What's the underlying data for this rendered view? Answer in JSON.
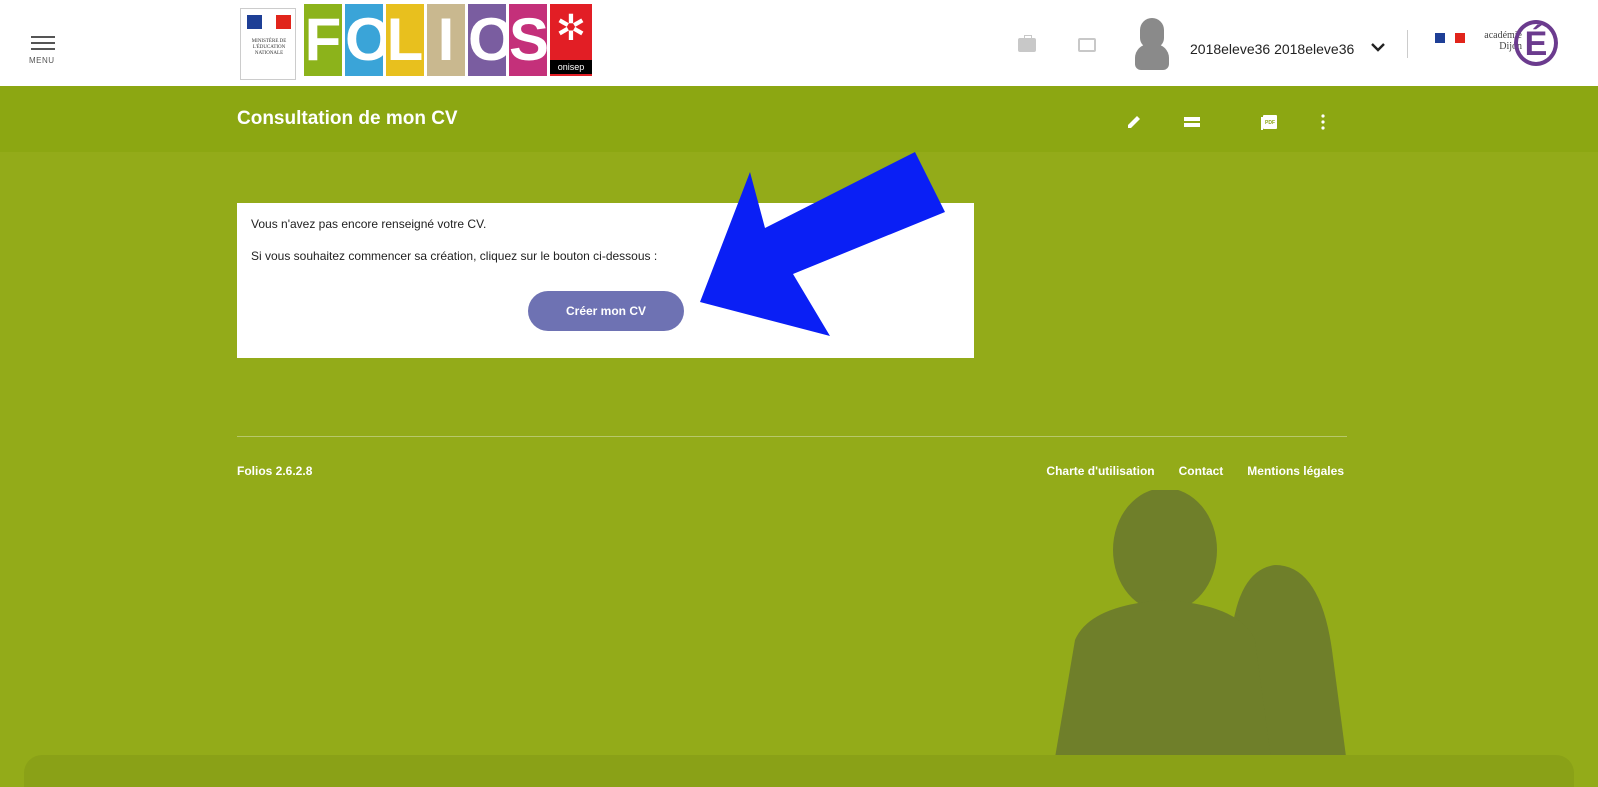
{
  "header": {
    "menu_label": "MENU",
    "gov_text": "MINISTÈRE DE L'ÉDUCATION NATIONALE",
    "logo_letters": [
      "F",
      "O",
      "L",
      "I",
      "O",
      "S"
    ],
    "logo_colors": [
      "#8cb31b",
      "#3aa4d8",
      "#e8c01e",
      "#c9b88f",
      "#7a5da0",
      "#c4307a"
    ],
    "onisep_label": "onisep",
    "username": "2018eleve36 2018eleve36",
    "academy_words": "académie Dijon",
    "academy_letter": "É"
  },
  "titlebar": {
    "title": "Consultation de mon CV",
    "pdf_label": "PDF"
  },
  "card": {
    "line1": "Vous n'avez pas encore renseigné votre CV.",
    "line2": "Si vous souhaitez commencer sa création, cliquez sur le bouton ci-dessous :",
    "button_label": "Créer mon CV"
  },
  "footer": {
    "version": "Folios 2.6.2.8",
    "links": [
      "Charte d'utilisation",
      "Contact",
      "Mentions légales"
    ]
  },
  "colors": {
    "page_bg": "#93ab19",
    "titlebar_bg": "#8ca712",
    "button_bg": "#6e72b3",
    "annotation_arrow": "#0a1ff5"
  }
}
